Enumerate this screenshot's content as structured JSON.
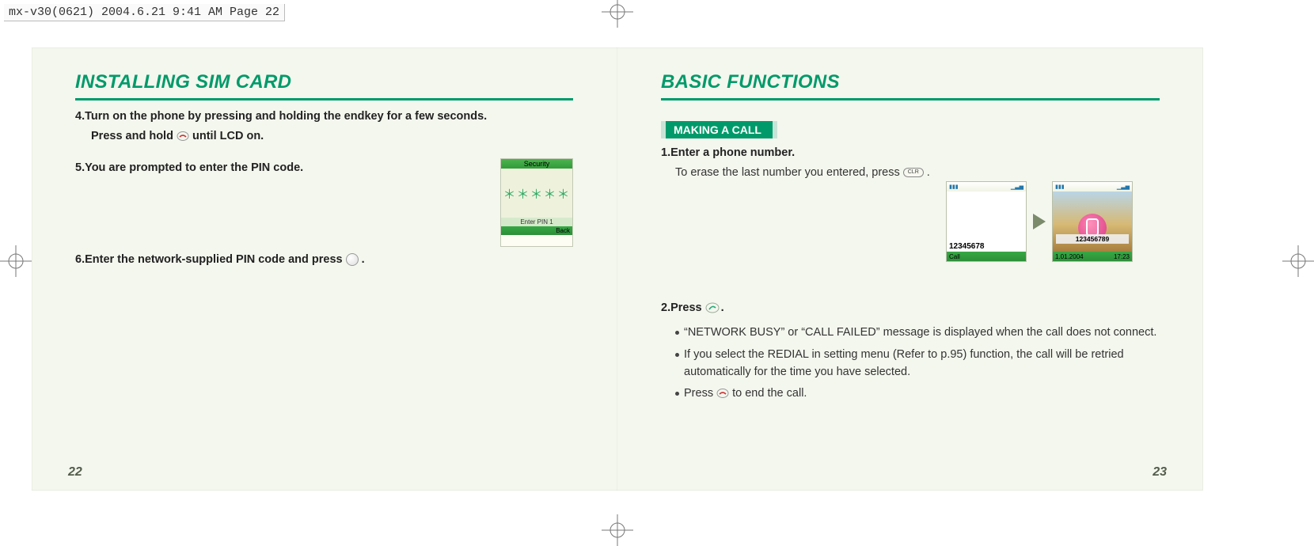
{
  "header_strip": "mx-v30(0621)  2004.6.21  9:41 AM  Page 22",
  "left": {
    "title": "INSTALLING SIM CARD",
    "step4_line": "4.Turn on the phone by pressing and holding the endkey for a few seconds.",
    "step4_sub_prefix": "Press and hold ",
    "step4_sub_suffix": " until LCD on.",
    "step5_line": "5.You are prompted to enter the PIN code.",
    "step6_prefix": "6.Enter the network-supplied PIN code and press ",
    "step6_suffix": " .",
    "screenshot": {
      "title": "Security",
      "stars": "＊＊＊＊＊",
      "prompt": "Enter PIN 1",
      "soft_right": "Back"
    },
    "page_number": "22"
  },
  "right": {
    "title": "BASIC FUNCTIONS",
    "subheading": "MAKING A CALL",
    "step1_line": "1.Enter a phone number.",
    "step1_body_prefix": "To erase the last number you entered, press  ",
    "clr_key_label": "CLR",
    "step1_body_suffix": ".",
    "screen1": {
      "number": "12345678",
      "soft_left": "Call"
    },
    "screen2": {
      "number": "123456789",
      "date": "1.01.2004",
      "time": "17:23"
    },
    "step2_prefix": "2.Press",
    "step2_suffix": " .",
    "bullet1": "“NETWORK BUSY” or “CALL FAILED” message is displayed when the call does not connect.",
    "bullet2": "If you select the REDIAL in setting menu (Refer to p.95) function, the call will be retried automatically for the time you have selected.",
    "bullet3_prefix": "Press  ",
    "bullet3_suffix": " to end the call.",
    "page_number": "23"
  }
}
